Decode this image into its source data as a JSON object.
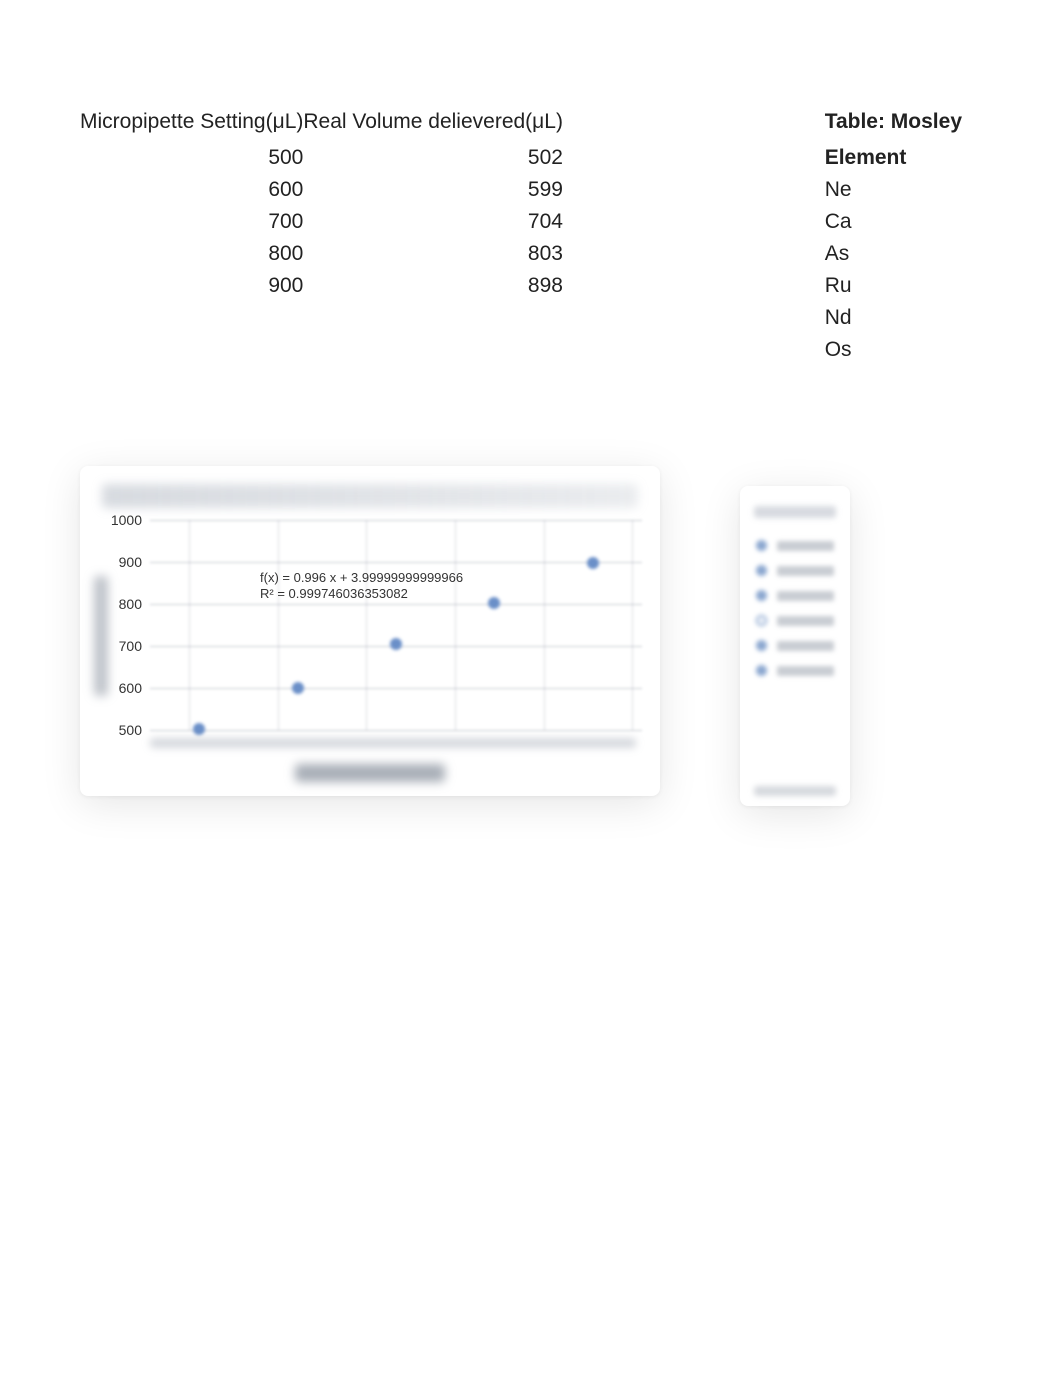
{
  "tables": {
    "left": {
      "headers": [
        "Micropipette Setting(μL)",
        "Real Volume delievered(μL)"
      ],
      "rows": [
        {
          "setting": "500",
          "volume": "502"
        },
        {
          "setting": "600",
          "volume": "599"
        },
        {
          "setting": "700",
          "volume": "704"
        },
        {
          "setting": "800",
          "volume": "803"
        },
        {
          "setting": "900",
          "volume": "898"
        }
      ]
    },
    "right": {
      "title": "Table: Mosley",
      "header": "Element",
      "rows": [
        "Ne",
        "Ca",
        "As",
        "Ru",
        "Nd",
        "Os"
      ]
    }
  },
  "chart_data": {
    "type": "scatter",
    "title": "Graph — Micropipette: Volume delivered vs. Volume Setting(μL)",
    "xlabel": "Micropipette Setting",
    "ylabel": "Volume delivered",
    "x": [
      500,
      600,
      700,
      800,
      900
    ],
    "y": [
      502,
      599,
      704,
      803,
      898
    ],
    "y_ticks": [
      500,
      600,
      700,
      800,
      900,
      1000
    ],
    "ylim": [
      450,
      1050
    ],
    "xlim": [
      450,
      950
    ],
    "trend": {
      "equation_text": "f(x) = 0.996 x + 3.99999999999966",
      "r2_text": "R² = 0.999746036353082"
    }
  }
}
